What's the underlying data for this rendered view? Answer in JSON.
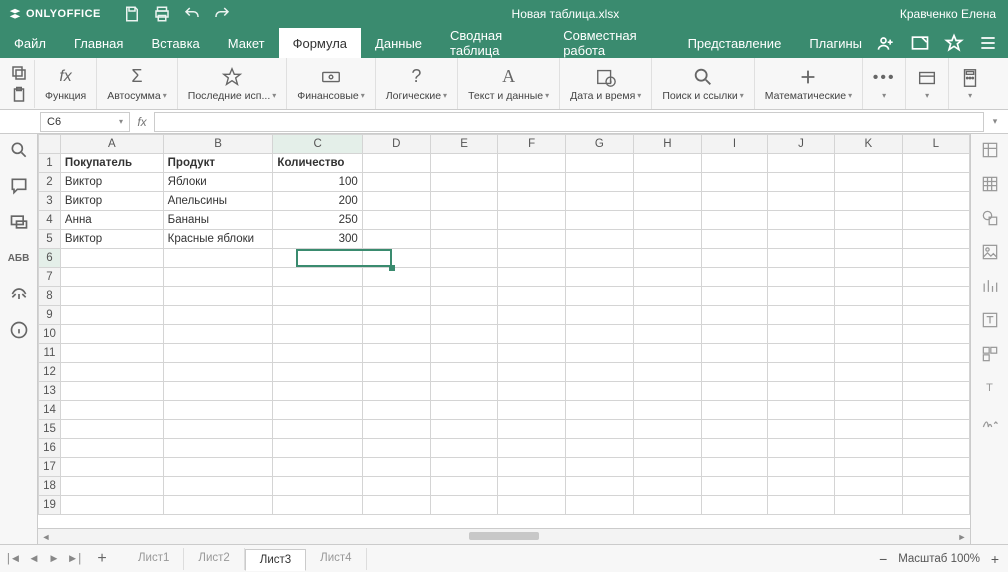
{
  "app": {
    "name": "ONLYOFFICE",
    "doc_title": "Новая таблица.xlsx",
    "user": "Кравченко Елена"
  },
  "menu": {
    "items": [
      "Файл",
      "Главная",
      "Вставка",
      "Макет",
      "Формула",
      "Данные",
      "Сводная таблица",
      "Совместная работа",
      "Представление",
      "Плагины"
    ],
    "active_index": 4
  },
  "ribbon": {
    "func": "Функция",
    "autosum": "Автосумма",
    "recent": "Последние исп...",
    "financial": "Финансовые",
    "logical": "Логические",
    "text": "Текст и данные",
    "datetime": "Дата и время",
    "lookup": "Поиск и ссылки",
    "math": "Математические"
  },
  "namebox": {
    "cell": "C6",
    "formula": ""
  },
  "columns": [
    "A",
    "B",
    "C",
    "D",
    "E",
    "F",
    "G",
    "H",
    "I",
    "J",
    "K",
    "L"
  ],
  "active_col_index": 2,
  "active_row": 6,
  "row_count": 19,
  "headers": {
    "A": "Покупатель",
    "B": "Продукт",
    "C": "Количество"
  },
  "data_rows": [
    {
      "A": "Виктор",
      "B": "Яблоки",
      "C": "100"
    },
    {
      "A": "Виктор",
      "B": "Апельсины",
      "C": "200"
    },
    {
      "A": "Анна",
      "B": "Бананы",
      "C": "250"
    },
    {
      "A": "Виктор",
      "B": "Красные яблоки",
      "C": "300"
    }
  ],
  "sheets": {
    "tabs": [
      "Лист1",
      "Лист2",
      "Лист3",
      "Лист4"
    ],
    "active_index": 2
  },
  "zoom": {
    "label": "Масштаб 100%"
  }
}
